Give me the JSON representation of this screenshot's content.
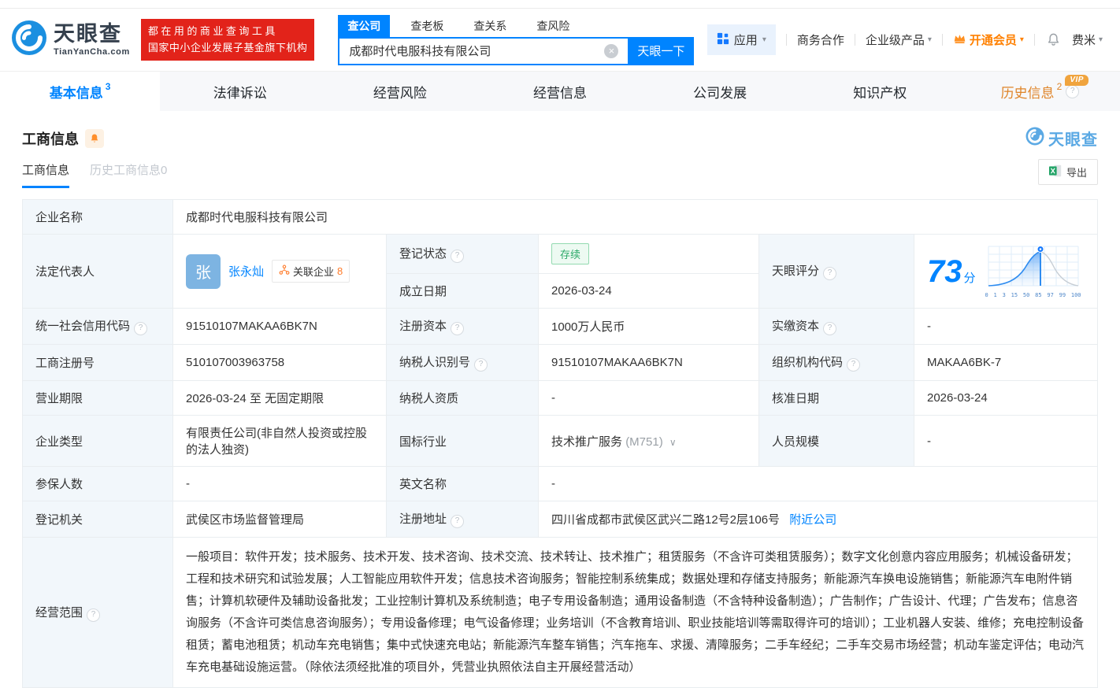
{
  "icons": {
    "caret": "▾",
    "question": "?",
    "close": "×",
    "chevron": "∨"
  },
  "header": {
    "logo": {
      "title": "天眼查",
      "subtitle": "TianYanCha.com"
    },
    "promo": {
      "line1": "都在用的商业查询工具",
      "line2": "国家中小企业发展子基金旗下机构"
    },
    "search": {
      "tabs": [
        {
          "label": "查公司"
        },
        {
          "label": "查老板"
        },
        {
          "label": "查关系"
        },
        {
          "label": "查风险"
        }
      ],
      "value": "成都时代电服科技有限公司",
      "button": "天眼一下"
    },
    "menu": {
      "apps": "应用",
      "cooperation": "商务合作",
      "enterprise": "企业级产品",
      "vip": "开通会员",
      "user": "费米"
    }
  },
  "nav_tabs": [
    {
      "label": "基本信息",
      "count": "3"
    },
    {
      "label": "法律诉讼"
    },
    {
      "label": "经营风险"
    },
    {
      "label": "经营信息"
    },
    {
      "label": "公司发展"
    },
    {
      "label": "知识产权"
    },
    {
      "label": "历史信息",
      "count": "2",
      "badge": "VIP"
    }
  ],
  "section": {
    "title": "工商信息",
    "watermark": "天眼查",
    "subtabs": [
      {
        "label": "工商信息"
      },
      {
        "label": "历史工商信息0"
      }
    ],
    "export_label": "导出"
  },
  "fields": {
    "company_name": {
      "label": "企业名称",
      "value": "成都时代电服科技有限公司"
    },
    "legal_rep": {
      "label": "法定代表人",
      "avatar": "张",
      "name": "张永灿",
      "related_label": "关联企业",
      "related_count": "8"
    },
    "reg_status": {
      "label": "登记状态",
      "value": "存续"
    },
    "establish_date": {
      "label": "成立日期",
      "value": "2026-03-24"
    },
    "score": {
      "label": "天眼评分",
      "value": "73",
      "unit": "分"
    },
    "credit_code": {
      "label": "统一社会信用代码",
      "value": "91510107MAKAA6BK7N"
    },
    "reg_capital": {
      "label": "注册资本",
      "value": "1000万人民币"
    },
    "paid_capital": {
      "label": "实缴资本",
      "value": "-"
    },
    "reg_number": {
      "label": "工商注册号",
      "value": "510107003963758"
    },
    "taxpayer_id": {
      "label": "纳税人识别号",
      "value": "91510107MAKAA6BK7N"
    },
    "org_code": {
      "label": "组织机构代码",
      "value": "MAKAA6BK-7"
    },
    "business_term": {
      "label": "营业期限",
      "value": "2026-03-24 至 无固定期限"
    },
    "taxpayer_qual": {
      "label": "纳税人资质",
      "value": "-"
    },
    "approval_date": {
      "label": "核准日期",
      "value": "2026-03-24"
    },
    "company_type": {
      "label": "企业类型",
      "value": "有限责任公司(非自然人投资或控股的法人独资)"
    },
    "industry": {
      "label": "国标行业",
      "value": "技术推广服务",
      "code": "(M751)"
    },
    "staff_size": {
      "label": "人员规模",
      "value": "-"
    },
    "insured_count": {
      "label": "参保人数",
      "value": "-"
    },
    "english_name": {
      "label": "英文名称",
      "value": "-"
    },
    "reg_authority": {
      "label": "登记机关",
      "value": "武侯区市场监督管理局"
    },
    "reg_address": {
      "label": "注册地址",
      "value": "四川省成都市武侯区武兴二路12号2层106号",
      "link": "附近公司"
    },
    "business_scope": {
      "label": "经营范围",
      "value": "一般项目：软件开发；技术服务、技术开发、技术咨询、技术交流、技术转让、技术推广；租赁服务（不含许可类租赁服务）；数字文化创意内容应用服务；机械设备研发；工程和技术研究和试验发展；人工智能应用软件开发；信息技术咨询服务；智能控制系统集成；数据处理和存储支持服务；新能源汽车换电设施销售；新能源汽车电附件销售；计算机软硬件及辅助设备批发；工业控制计算机及系统制造；电子专用设备制造；通用设备制造（不含特种设备制造）；广告制作；广告设计、代理；广告发布；信息咨询服务（不含许可类信息咨询服务）；专用设备修理；电气设备修理；业务培训（不含教育培训、职业技能培训等需取得许可的培训）；工业机器人安装、维修；充电控制设备租赁；蓄电池租赁；机动车充电销售；集中式快速充电站；新能源汽车整车销售；汽车拖车、求援、清障服务；二手车经纪；二手车交易市场经营；机动车鉴定评估；电动汽车充电基础设施运营。（除依法须经批准的项目外，凭营业执照依法自主开展经营活动）"
    }
  },
  "score_chart": {
    "type": "area",
    "ticks": [
      "0",
      "1",
      "3",
      "15",
      "50",
      "85",
      "97",
      "99",
      "100"
    ],
    "marker_value": 73
  }
}
